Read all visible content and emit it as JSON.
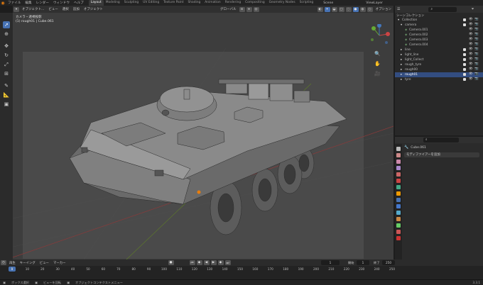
{
  "topbar": {
    "menus": [
      "ファイル",
      "編集",
      "レンダー",
      "ウィンドウ",
      "ヘルプ"
    ],
    "workspaces": [
      "Layout",
      "Modeling",
      "Sculpting",
      "UV Editing",
      "Texture Paint",
      "Shading",
      "Animation",
      "Rendering",
      "Compositing",
      "Geometry Nodes",
      "Scripting"
    ],
    "active_workspace": "Layout",
    "scene": "Scene",
    "view_layer": "ViewLayer"
  },
  "viewport": {
    "mode": "オブジェクト...",
    "menus": [
      "ビュー",
      "選択",
      "追加",
      "オブジェクト"
    ],
    "transform": "グローバル",
    "options": "オプション",
    "camera_title": "カメラ・透視投影",
    "camera_sub": "(1) rough01 | Cube.061"
  },
  "outliner": {
    "title": "シーンコレクション",
    "rows": [
      {
        "label": "Collection",
        "indent": 0,
        "icon": "collection-icon"
      },
      {
        "label": "camera",
        "indent": 1,
        "icon": "collection-icon"
      },
      {
        "label": "Camera.001",
        "indent": 2,
        "icon": "camera-icon"
      },
      {
        "label": "Camera.002",
        "indent": 2,
        "icon": "camera-icon"
      },
      {
        "label": "Camera.003",
        "indent": 2,
        "icon": "camera-icon"
      },
      {
        "label": "Camera.004",
        "indent": 2,
        "icon": "camera-icon"
      },
      {
        "label": "line",
        "indent": 1,
        "icon": "collection-icon"
      },
      {
        "label": "light_line",
        "indent": 1,
        "icon": "collection-icon"
      },
      {
        "label": "light_Collect",
        "indent": 1,
        "icon": "collection-icon"
      },
      {
        "label": "rough_tyre",
        "indent": 1,
        "icon": "collection-icon"
      },
      {
        "label": "rough00",
        "indent": 1,
        "icon": "collection-icon"
      },
      {
        "label": "rough01",
        "indent": 1,
        "icon": "collection-icon"
      },
      {
        "label": "tyre",
        "indent": 1,
        "icon": "collection-icon"
      }
    ]
  },
  "properties": {
    "object_name": "Cube.061",
    "add_modifier": "モディファイアーを追加"
  },
  "timeline": {
    "menus": [
      "再生",
      "キーイング",
      "ビュー",
      "マーカー"
    ],
    "current_frame": "1",
    "start_label": "開始",
    "start": "1",
    "end_label": "終了",
    "end": "250",
    "frame_ticks": [
      "0",
      "10",
      "20",
      "30",
      "40",
      "50",
      "60",
      "70",
      "80",
      "90",
      "100",
      "110",
      "120",
      "130",
      "140",
      "150",
      "160",
      "170",
      "180",
      "190",
      "200",
      "210",
      "220",
      "230",
      "240",
      "250"
    ]
  },
  "statusbar": {
    "select": "ボックス選択",
    "rotate": "ビューを回転",
    "context": "オブジェクトコンテクストメニュー",
    "version": "3.3.1"
  },
  "colors": {
    "accent": "#4772b3",
    "orange": "#e87d0d",
    "viewport_bg": "#3d3d3d"
  }
}
